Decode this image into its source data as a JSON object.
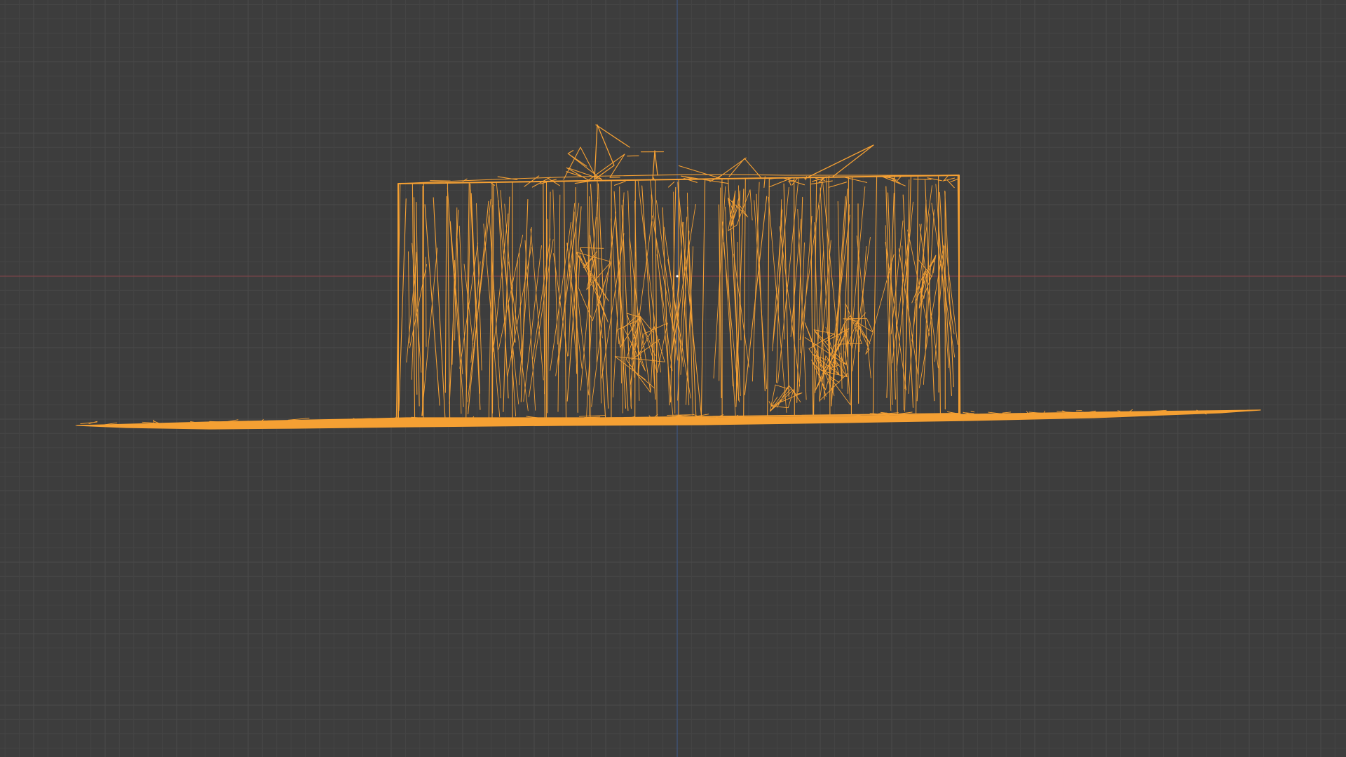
{
  "app": {
    "view": "3d-viewport",
    "mode": "wireframe",
    "projection": "orthographic-front"
  },
  "viewport": {
    "background_color": "#3d3d3d",
    "grid": {
      "visible": true,
      "minor_color": "#454545",
      "major_color": "#4a4a4a"
    },
    "axes": {
      "x_axis_color": "#7a4448",
      "z_axis_color": "#3f5680"
    },
    "object": {
      "selected": true,
      "wire_color": "#f5a033",
      "origin_marker": "origin-dot"
    }
  }
}
